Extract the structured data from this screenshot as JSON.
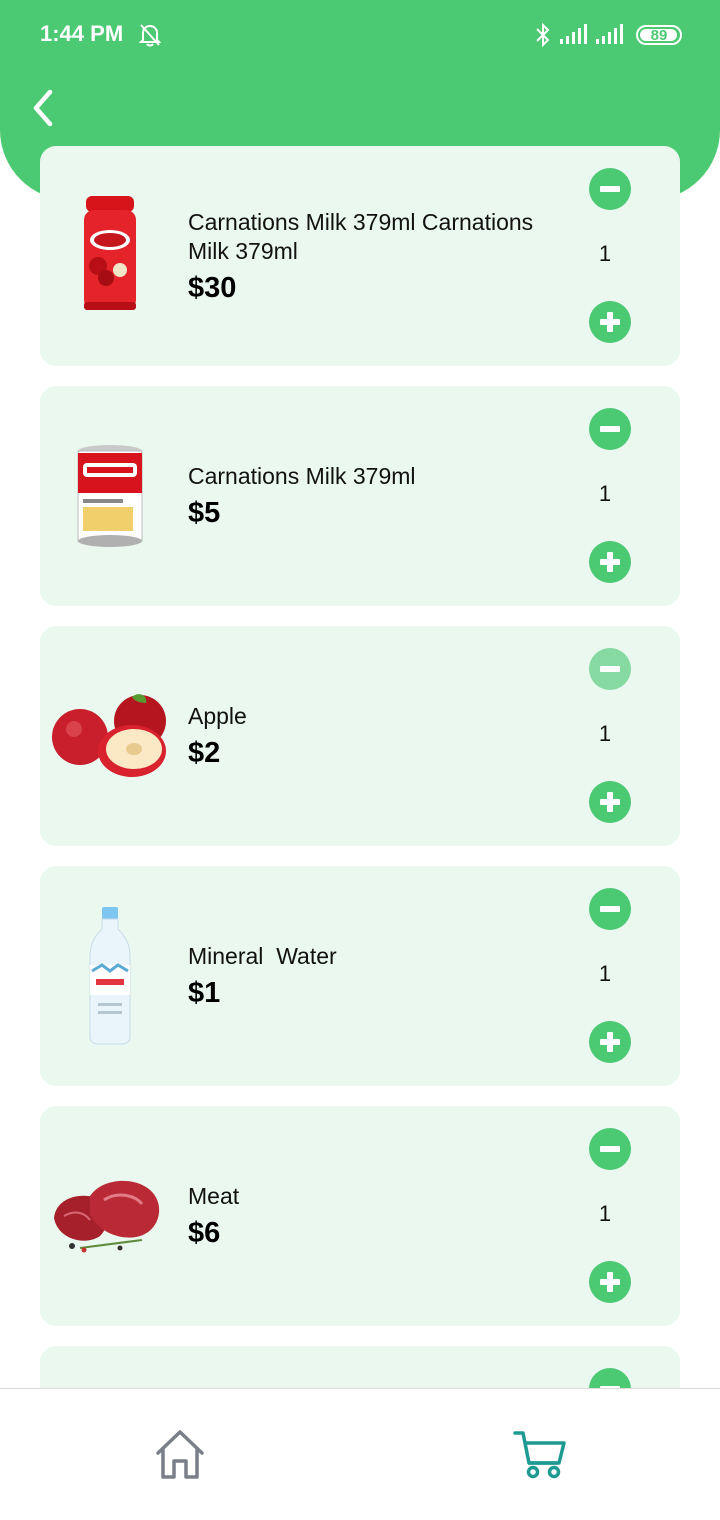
{
  "status_bar": {
    "time": "1:44 PM",
    "battery": "89"
  },
  "cart": {
    "items": [
      {
        "name": "Carnations Milk 379ml Carnations Milk 379ml",
        "price": "$30",
        "quantity": "1",
        "image": "strawberry-jar-image"
      },
      {
        "name": "Carnations Milk 379ml",
        "price": "$5",
        "quantity": "1",
        "image": "milk-can-image"
      },
      {
        "name": "Apple",
        "price": "$2",
        "quantity": "1",
        "image": "apple-image"
      },
      {
        "name": "Mineral  Water",
        "price": "$1",
        "quantity": "1",
        "image": "water-bottle-image"
      },
      {
        "name": "Meat",
        "price": "$6",
        "quantity": "1",
        "image": "meat-image"
      }
    ]
  },
  "nav": {
    "items": [
      "home-icon",
      "cart-icon"
    ]
  },
  "colors": {
    "brand_green": "#4cc973",
    "card_bg": "#eaf8ef",
    "cart_icon": "#1f9a92",
    "home_icon": "#7a7f8a"
  }
}
